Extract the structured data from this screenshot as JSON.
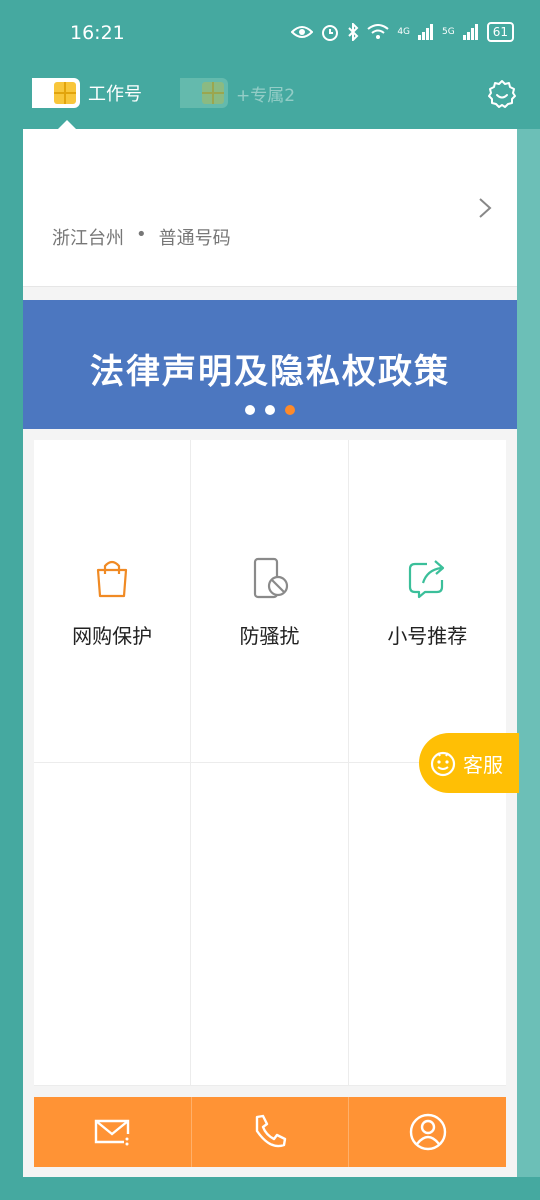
{
  "status_bar": {
    "time": "16:21",
    "battery": "61",
    "network_1": "4G",
    "network_2": "5G"
  },
  "sim_tabs": [
    {
      "label": "工作号",
      "active": true
    },
    {
      "label": "+专属2",
      "active": false
    }
  ],
  "number_panel": {
    "region": "浙江台州",
    "separator": "•",
    "type": "普通号码"
  },
  "banner": {
    "text": "法律声明及隐私权政策",
    "dots": 3,
    "active_dot": 3
  },
  "features": [
    {
      "label": "网购保护",
      "icon": "shopping-bag-icon",
      "color": "#f08a24"
    },
    {
      "label": "防骚扰",
      "icon": "phone-block-icon",
      "color": "#8a8a8a"
    },
    {
      "label": "小号推荐",
      "icon": "share-icon",
      "color": "#3bbf9a"
    }
  ],
  "service": {
    "label": "客服"
  },
  "bottom_nav": [
    {
      "icon": "mail-icon"
    },
    {
      "icon": "phone-icon"
    },
    {
      "icon": "user-icon"
    }
  ],
  "colors": {
    "background": "#45a9a0",
    "banner": "#4c77c0",
    "accent": "#ff9335",
    "service": "#ffbf05"
  }
}
